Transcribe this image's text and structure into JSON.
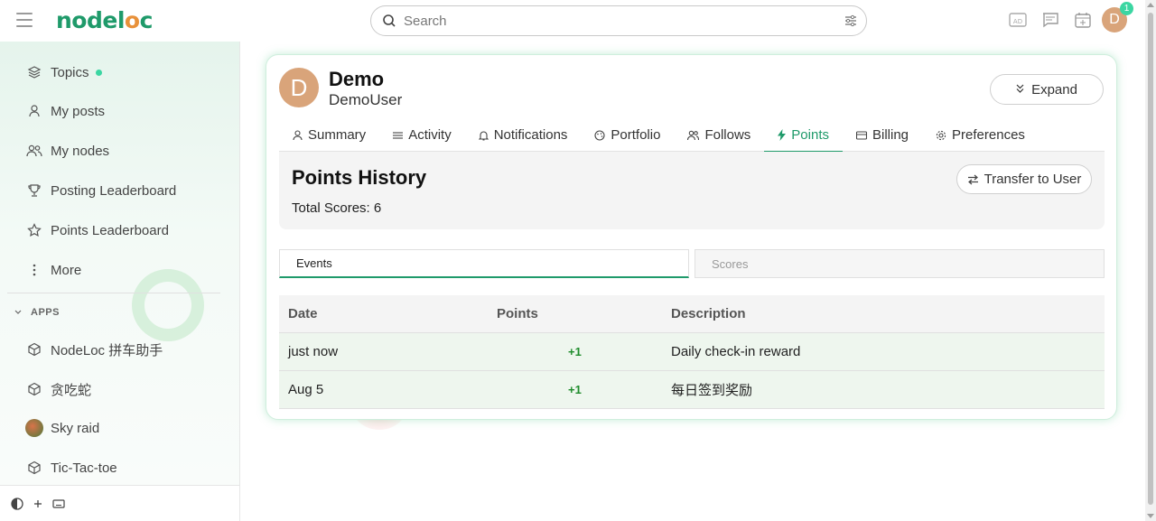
{
  "header": {
    "logo": {
      "part1": "node",
      "part2": "l",
      "part3": "o",
      "part4": "c"
    },
    "search": {
      "placeholder": "Search"
    },
    "notification_count": "1",
    "avatar_letter": "D"
  },
  "sidebar": {
    "items": [
      {
        "label": "Topics",
        "icon": "layers-icon"
      },
      {
        "label": "My posts",
        "icon": "user-icon"
      },
      {
        "label": "My nodes",
        "icon": "users-icon"
      },
      {
        "label": "Posting Leaderboard",
        "icon": "trophy-icon"
      },
      {
        "label": "Points Leaderboard",
        "icon": "star-icon"
      },
      {
        "label": "More",
        "icon": "more-vertical-icon"
      }
    ],
    "apps_title": "APPS",
    "apps": [
      {
        "label": "NodeLoc 拼车助手"
      },
      {
        "label": "贪吃蛇"
      },
      {
        "label": "Sky raid"
      },
      {
        "label": "Tic-Tac-toe"
      }
    ]
  },
  "profile": {
    "avatar_letter": "D",
    "name": "Demo",
    "username": "DemoUser",
    "expand_label": "Expand",
    "tabs": [
      {
        "label": "Summary"
      },
      {
        "label": "Activity"
      },
      {
        "label": "Notifications"
      },
      {
        "label": "Portfolio"
      },
      {
        "label": "Follows"
      },
      {
        "label": "Points"
      },
      {
        "label": "Billing"
      },
      {
        "label": "Preferences"
      }
    ]
  },
  "points": {
    "title": "Points History",
    "total": "Total Scores: 6",
    "transfer_label": "Transfer to User",
    "subtabs": [
      {
        "label": "Events"
      },
      {
        "label": "Scores"
      }
    ],
    "columns": [
      "Date",
      "Points",
      "Description"
    ],
    "rows": [
      {
        "date": "just now",
        "points": "+1",
        "description": "Daily check-in reward"
      },
      {
        "date": "Aug 5",
        "points": "+1",
        "description": "每日签到奖励"
      }
    ]
  },
  "colors": {
    "accent": "#1f9a6a",
    "brand_orange": "#e8913a",
    "avatar": "#d9a47a",
    "positive": "#1f8c2c"
  }
}
